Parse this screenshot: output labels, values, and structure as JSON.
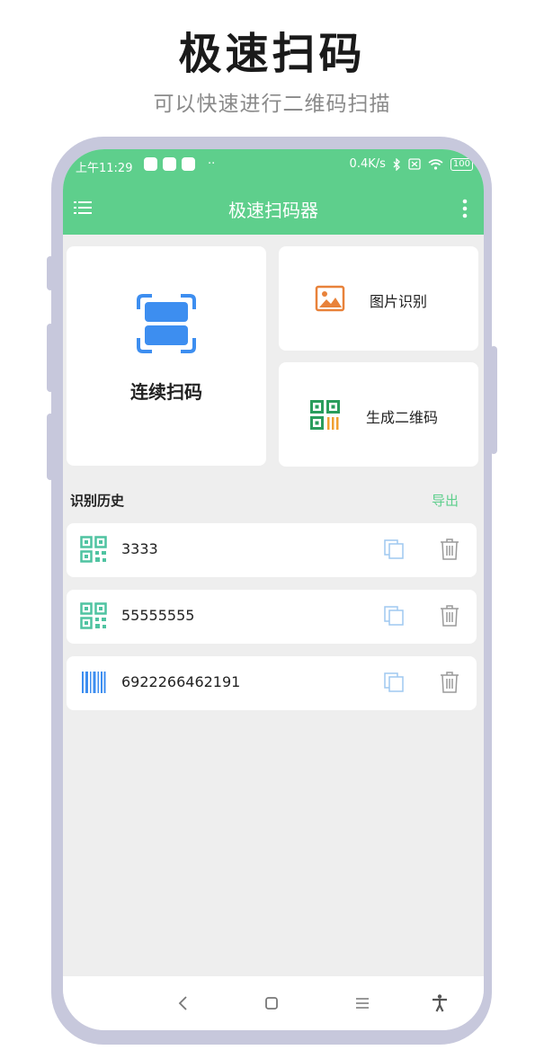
{
  "promo": {
    "title": "极速扫码",
    "subtitle": "可以快速进行二维码扫描"
  },
  "status_bar": {
    "time": "上午11:29",
    "network_speed": "0.4K/s",
    "battery": "100",
    "dots": "··"
  },
  "app_bar": {
    "title": "极速扫码器"
  },
  "actions": {
    "continuous_scan": "连续扫码",
    "image_recognition": "图片识别",
    "generate_qr": "生成二维码"
  },
  "history": {
    "title": "识别历史",
    "export": "导出",
    "items": [
      {
        "type": "qrcode",
        "text": "3333"
      },
      {
        "type": "qrcode",
        "text": "55555555"
      },
      {
        "type": "barcode",
        "text": "6922266462191"
      }
    ]
  },
  "colors": {
    "accent": "#5ecf8c",
    "scan_blue": "#3d8ef0",
    "image_orange": "#e8823a",
    "qr_green": "#2a9d5c",
    "qr_orange": "#f0a030",
    "icon_teal": "#4fc3a1",
    "copy_blue": "#9fc8f0",
    "delete_gray": "#9a9a9a"
  }
}
